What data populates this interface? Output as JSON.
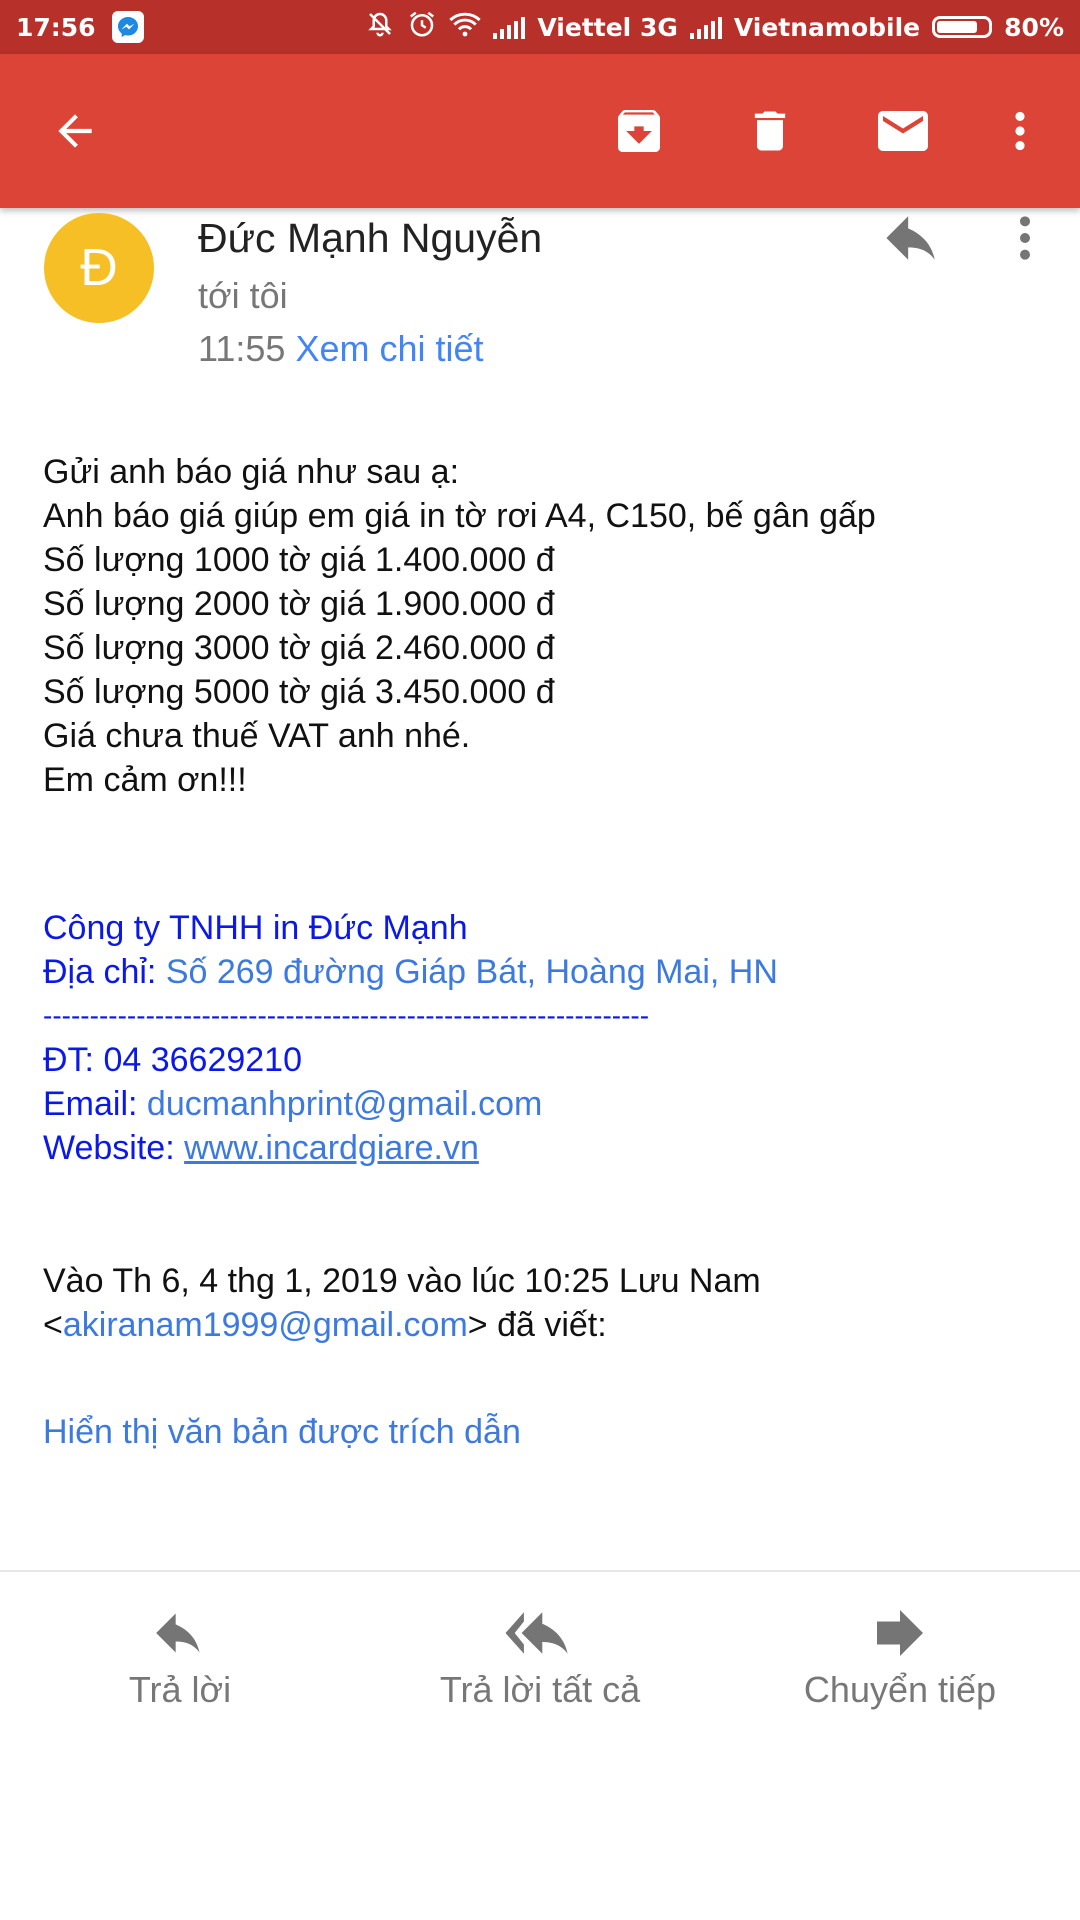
{
  "status_bar": {
    "time": "17:56",
    "carrier1": "Viettel 3G",
    "carrier2": "Vietnamobile",
    "battery_text": "80%",
    "battery_level": 0.8,
    "icons": [
      "messenger-icon",
      "mute-icon",
      "alarm-icon",
      "wifi-icon",
      "signal-icon",
      "battery-icon"
    ]
  },
  "toolbar": {
    "icons": [
      "back-arrow-icon",
      "archive-icon",
      "trash-icon",
      "mail-icon",
      "more-vert-icon"
    ],
    "color": "#db4437"
  },
  "email": {
    "avatar_letter": "Đ",
    "avatar_color": "#f6bf26",
    "sender": "Đức Mạnh Nguyễn",
    "recipient": "tới tôi",
    "time": "11:55",
    "details_link": "Xem chi tiết",
    "body_lines": [
      "Gửi anh báo giá như sau ạ:",
      "Anh báo giá giúp em giá in tờ rơi A4, C150, bế gân gấp",
      "Số lượng 1000 tờ giá 1.400.000 đ",
      "Số lượng 2000 tờ giá 1.900.000 đ",
      "Số lượng 3000 tờ giá 2.460.000 đ",
      "Số lượng 5000 tờ giá 3.450.000 đ",
      "Giá chưa thuế VAT anh nhé.",
      "Em cảm ơn!!!"
    ],
    "signature": {
      "company": "Công ty TNHH in Đức Mạnh",
      "address_label": "Địa chỉ:",
      "address": "Số 269 đường Giáp Bát, Hoàng Mai, HN",
      "separator": "-----------------------------------------------------------------",
      "phone": "ĐT: 04 36629210",
      "email_label": "Email:",
      "email": "ducmanhprint@gmail.com",
      "website_label": "Website:",
      "website": "www.incardgiare.vn"
    },
    "quote_header_line1": "Vào Th 6, 4 thg 1, 2019 vào lúc 10:25 Lưu Nam",
    "quote_open": "<",
    "quote_email": "akiranam1999@gmail.com",
    "quote_close": "> đã viết:",
    "show_quoted": "Hiển thị văn bản được trích dẫn"
  },
  "actions": {
    "reply": "Trả lời",
    "reply_all": "Trả lời tất cả",
    "forward": "Chuyển tiếp"
  },
  "colors": {
    "status_bar": "#b8302a",
    "link": "#3c7ae0",
    "signature": "#0b19e8"
  }
}
